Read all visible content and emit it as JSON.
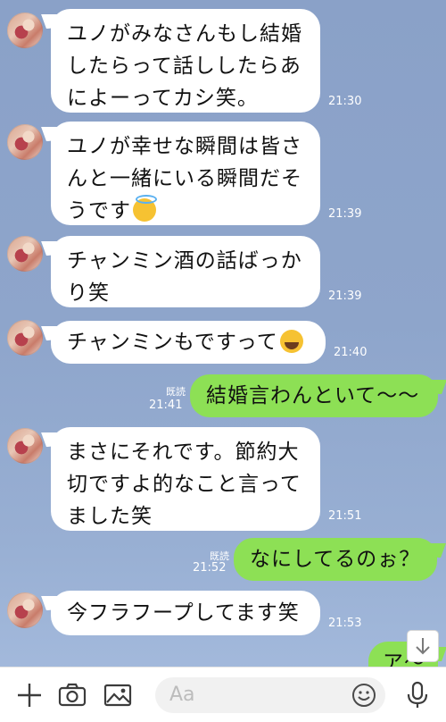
{
  "messages": [
    {
      "lines": [
        "ユノがみなさんもし結婚",
        "したらって話ししたらあ",
        "によーってカシ笑。"
      ],
      "time": "21:30"
    },
    {
      "lines": [
        "ユノが幸せな瞬間は皆さ",
        "んと一緒にいる瞬間だそ",
        "うです"
      ],
      "emoji": "smiling-face-with-halo",
      "time": "21:39"
    },
    {
      "lines": [
        "チャンミン酒の話ばっか",
        "り笑"
      ],
      "time": "21:39"
    },
    {
      "lines": [
        "チャンミンもですって"
      ],
      "emoji": "loudly-crying-face",
      "time": "21:40"
    },
    {
      "out": true,
      "read": "既読",
      "lines": [
        "結婚言わんといて〜〜"
      ],
      "time": "21:41"
    },
    {
      "lines": [
        "まさにそれです。節約大",
        "切ですよ的なこと言って",
        "ました笑"
      ],
      "time": "21:51"
    },
    {
      "out": true,
      "read": "既読",
      "lines": [
        "なにしてるのぉ？"
      ],
      "time": "21:52"
    },
    {
      "lines": [
        "今フラフープしてます笑"
      ],
      "time": "21:53"
    },
    {
      "out": true,
      "lines": [
        "ア〜"
      ],
      "partial": true
    }
  ],
  "input": {
    "placeholder": "Aa"
  },
  "icons": [
    "plus-icon",
    "camera-icon",
    "image-icon",
    "emoji-icon",
    "microphone-icon",
    "scroll-down-arrow-icon"
  ],
  "colors": {
    "incoming": "#ffffff",
    "outgoing": "#8de055",
    "background": "#8ea5cb"
  }
}
